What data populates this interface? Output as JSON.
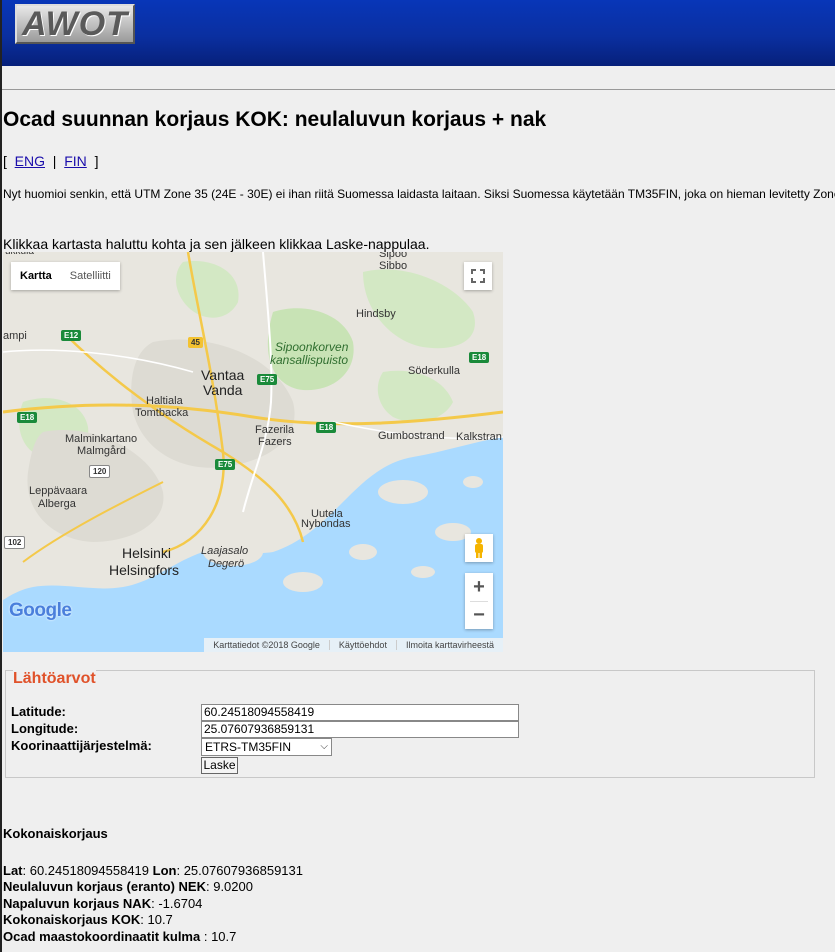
{
  "header": {
    "logo_text": "AWOT"
  },
  "page": {
    "title": "Ocad suunnan korjaus KOK: neulaluvun korjaus + nak",
    "lang_open": "[",
    "lang_eng": "ENG",
    "lang_sep": "|",
    "lang_fin": "FIN",
    "lang_close": "]",
    "note": "Nyt huomioi senkin, että UTM Zone 35 (24E - 30E) ei ihan riitä Suomessa laidasta laitaan. Siksi Suomessa käytetään TM35FIN, joka on hieman levitetty Zone",
    "instruction": "Klikkaa kartasta haluttu kohta ja sen jälkeen klikkaa Laske-nappulaa."
  },
  "map": {
    "type_map": "Kartta",
    "type_satellite": "Satelliitti",
    "zoom_in": "+",
    "zoom_out": "−",
    "google_logo": "Google",
    "attribution": "Karttatiedot ©2018 Google",
    "terms": "Käyttöehdot",
    "report": "Ilmoita karttavirheestä",
    "labels": {
      "sipoo": "Sipoo",
      "sibbo": "Sibbo",
      "hindsby": "Hindsby",
      "park1": "Sipoonkorven",
      "park2": "kansallispuisto",
      "vantaa": "Vantaa",
      "vanda": "Vanda",
      "soderkulla": "Söderkulla",
      "haltiala": "Haltiala",
      "tomtbacka": "Tomtbacka",
      "fazerila": "Fazerila",
      "fazers": "Fazers",
      "gumbostrand": "Gumbostrand",
      "kalkstrand": "Kalkstran",
      "malminkartano": "Malminkartano",
      "malmgard": "Malmgård",
      "leppavaara": "Leppävaara",
      "alberga": "Alberga",
      "uutela": "Uutela",
      "nybondas": "Nybondas",
      "helsinki": "Helsinki",
      "helsingfors": "Helsingfors",
      "laajasalo": "Laajasalo",
      "degero": "Degerö",
      "ampi": "ampi",
      "nkkula": "ukkula"
    },
    "roads": {
      "e12": "E12",
      "r45": "45",
      "e75a": "E75",
      "e18a": "E18",
      "e18b": "E18",
      "e18c": "E18",
      "e75b": "E75",
      "r120": "120",
      "r102": "102"
    }
  },
  "form": {
    "legend": "Lähtöarvot",
    "lat_label": "Latitude:",
    "lat_value": "60.24518094558419",
    "lon_label": "Longitude:",
    "lon_value": "25.07607936859131",
    "crs_label": "Koorinaattijärjestelmä:",
    "crs_value": "ETRS-TM35FIN",
    "submit": "Laske"
  },
  "results": {
    "heading": "Kokonaiskorjaus",
    "lat_label": "Lat",
    "lat_value": ": 60.24518094558419",
    "lon_label": "Lon",
    "lon_value": ": 25.07607936859131",
    "nek_label": "Neulaluvun korjaus (eranto) NEK",
    "nek_value": ": 9.0200",
    "nak_label": "Napaluvun korjaus NAK",
    "nak_value": ": -1.6704",
    "kok_label": "Kokonaiskorjaus KOK",
    "kok_value": ": 10.7",
    "ocad_label": "Ocad maastokoordinaatit kulma",
    "ocad_value": " : 10.7"
  },
  "colors": {
    "header": "#0a2fa0",
    "legend": "#e0522a",
    "water": "#aadaff",
    "land": "#e8e6df",
    "park": "#c8e3b5"
  }
}
